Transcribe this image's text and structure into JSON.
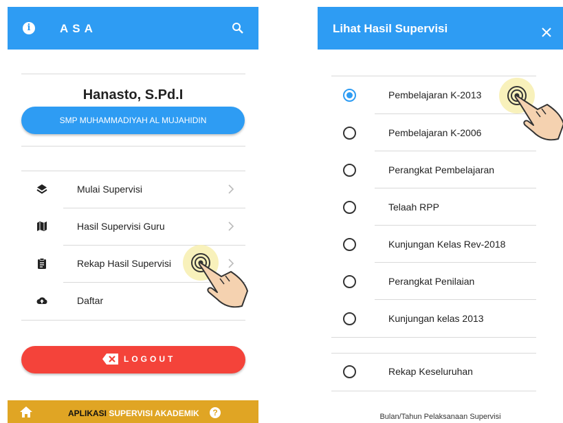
{
  "left": {
    "app_title": "ASA",
    "user_name": "Hanasto, S.Pd.I",
    "school": "SMP MUHAMMADIYAH AL MUJAHIDIN",
    "menu": [
      {
        "label": "Mulai Supervisi",
        "icon": "layers-icon"
      },
      {
        "label": "Hasil Supervisi Guru",
        "icon": "map-icon"
      },
      {
        "label": "Rekap Hasil Supervisi",
        "icon": "clipboard-icon"
      },
      {
        "label": "Daftar",
        "icon": "cloud-upload-icon"
      }
    ],
    "logout_label": "LOGOUT",
    "bottom_bar": {
      "part1": "APLIKASI",
      "part2": " SUPERVISI AKADEMIK"
    },
    "colors": {
      "primary": "#2e9cf3",
      "logout": "#f4433a",
      "bottom": "#e0a524"
    }
  },
  "right": {
    "dialog_title": "Lihat Hasil Supervisi",
    "options": [
      {
        "label": "Pembelajaran K-2013",
        "selected": true
      },
      {
        "label": "Pembelajaran K-2006",
        "selected": false
      },
      {
        "label": "Perangkat Pembelajaran",
        "selected": false
      },
      {
        "label": "Telaah RPP",
        "selected": false
      },
      {
        "label": "Kunjungan Kelas Rev-2018",
        "selected": false
      },
      {
        "label": "Perangkat Penilaian",
        "selected": false
      },
      {
        "label": "Kunjungan kelas 2013",
        "selected": false
      },
      {
        "label": "Rekap Keseluruhan",
        "selected": false
      }
    ],
    "footer": "Bulan/Tahun Pelaksanaan Supervisi"
  }
}
